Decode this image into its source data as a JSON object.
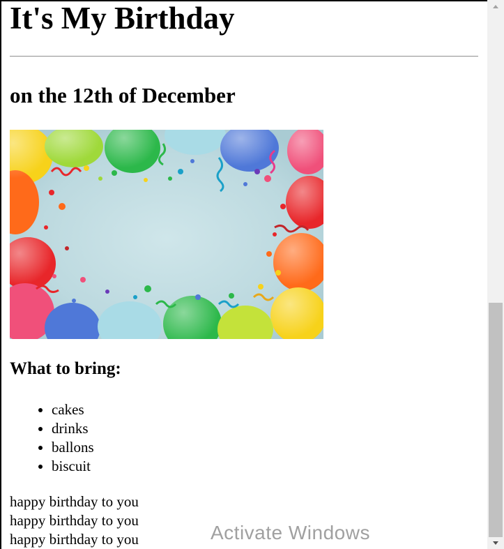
{
  "page": {
    "title": "It's My Birthday",
    "subtitle": "on the 12th of December"
  },
  "image": {
    "alt": "balloons"
  },
  "bring": {
    "heading": "What to bring:",
    "items": [
      "cakes",
      "drinks",
      "ballons",
      "biscuit"
    ]
  },
  "song": {
    "lines": [
      "happy birthday to you",
      "happy birthday to you",
      "happy birthday to you"
    ]
  },
  "watermark": {
    "text": "Activate Windows"
  },
  "colors": {
    "balloon_yellow": "#f7d21a",
    "balloon_green": "#2cb84a",
    "balloon_blue": "#4f78d8",
    "balloon_red": "#e8262a",
    "balloon_orange": "#ff6a1a",
    "balloon_pink": "#f0507a",
    "backdrop": "#c2dde3"
  }
}
